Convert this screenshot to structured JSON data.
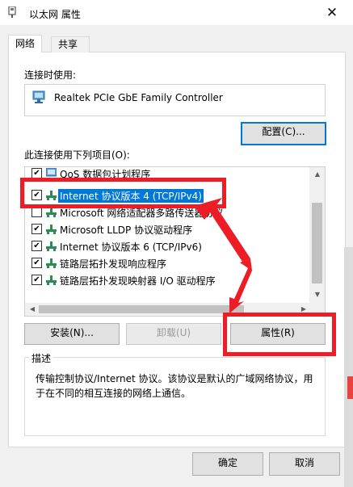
{
  "window": {
    "title": "以太网 属性",
    "close_glyph": "✕"
  },
  "tabs": [
    {
      "label": "网络",
      "active": true
    },
    {
      "label": "共享",
      "active": false
    }
  ],
  "connect_using": {
    "label": "连接时使用:",
    "adapter_name": "Realtek PCIe GbE Family Controller",
    "configure_button": "配置(C)..."
  },
  "items_section": {
    "label": "此连接使用下列项目(O):",
    "items": [
      {
        "label": "QoS 数据包计划程序",
        "checked": true,
        "selected": false
      },
      {
        "label": "Internet 协议版本 4 (TCP/IPv4)",
        "checked": true,
        "selected": true
      },
      {
        "label": "Microsoft 网络适配器多路传送器协议",
        "checked": false,
        "selected": false
      },
      {
        "label": "Microsoft LLDP 协议驱动程序",
        "checked": true,
        "selected": false
      },
      {
        "label": "Internet 协议版本 6 (TCP/IPv6)",
        "checked": true,
        "selected": false
      },
      {
        "label": "链路层拓扑发现响应程序",
        "checked": true,
        "selected": false
      },
      {
        "label": "链路层拓扑发现映射器 I/O 驱动程序",
        "checked": true,
        "selected": false
      }
    ],
    "check_glyph": "✔"
  },
  "actions": {
    "install": "安装(N)...",
    "uninstall": "卸载(U)",
    "properties": "属性(R)"
  },
  "description": {
    "title": "描述",
    "line1": "传输控制协议/Internet 协议。该协议是默认的广域网络协议，用",
    "line2": "于在不同的相互连接的网络上通信。"
  },
  "footer": {
    "ok": "确定",
    "cancel": "取消"
  },
  "colors": {
    "accent": "#0078d7",
    "annotation_red": "#ee1c25"
  }
}
